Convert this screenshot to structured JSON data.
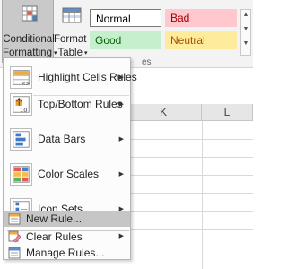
{
  "ribbon": {
    "conditional_formatting": {
      "line1": "Conditional",
      "line2": "Formatting",
      "caret": "▾"
    },
    "format_as_table": {
      "line1": "Format as",
      "line2": "Table",
      "caret": "▾"
    },
    "cell_styles": {
      "normal": "Normal",
      "bad": "Bad",
      "good": "Good",
      "neutral": "Neutral"
    },
    "group_label_fragment": "es",
    "style_colors": {
      "bad_fill": "#ffc7ce",
      "bad_text": "#9c0006",
      "good_fill": "#c6efce",
      "good_text": "#006100",
      "neutral_fill": "#ffeb9c",
      "neutral_text": "#9c5700"
    }
  },
  "sheet": {
    "column_headers": [
      "K",
      "L"
    ]
  },
  "menu": {
    "items": [
      {
        "label": "Highlight Cells Rules",
        "icon": "highlight-cells-icon",
        "submenu": true
      },
      {
        "label": "Top/Bottom Rules",
        "icon": "top-bottom-icon",
        "submenu": true
      },
      {
        "label": "Data Bars",
        "icon": "data-bars-icon",
        "submenu": true
      },
      {
        "label": "Color Scales",
        "icon": "color-scales-icon",
        "submenu": true
      },
      {
        "label": "Icon Sets",
        "icon": "icon-sets-icon",
        "submenu": true
      },
      {
        "label": "New Rule...",
        "icon": "new-rule-icon",
        "submenu": false,
        "hovered": true
      },
      {
        "label": "Clear Rules",
        "icon": "clear-rules-icon",
        "submenu": true
      },
      {
        "label": "Manage Rules...",
        "icon": "manage-rules-icon",
        "submenu": false
      }
    ],
    "submenu_glyph": "▶",
    "top_bottom_icon_text": "10"
  }
}
